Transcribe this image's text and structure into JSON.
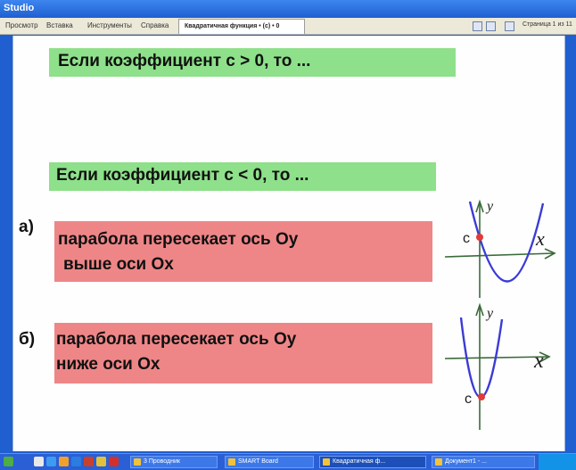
{
  "app": {
    "title": "Studio"
  },
  "menu": {
    "items": [
      "Просмотр",
      "Вставка",
      "Инструменты",
      "Справка"
    ],
    "doc_tab": "Квадратичная функция • (c) • 0",
    "page_indicator": "Страница 1 из 11"
  },
  "slide": {
    "line1": "Если коэффициент с > 0, то ...",
    "line2": "Если коэффициент с < 0, то ...",
    "option_a": {
      "letter": "а)",
      "line1": "парабола пересекает ось Оу",
      "line2": "выше оси  Ох"
    },
    "option_b": {
      "letter": "б)",
      "line1": "парабола пересекает ось Оу",
      "line2": "ниже оси Ох"
    },
    "graph_a": {
      "y_label": "y",
      "x_label": "x",
      "c_label": "c"
    },
    "graph_b": {
      "y_label": "y",
      "x_label": "x",
      "c_label": "c"
    }
  },
  "taskbar": {
    "tasks": [
      "3 Проводник",
      "SMART Board",
      "Квадратичная ф...",
      "Документ1 - ..."
    ]
  },
  "colors": {
    "green_box": "#8ee08a",
    "red_box": "#ee8687",
    "parabola": "#3b3bd6",
    "intercept": "#e03a3a"
  }
}
